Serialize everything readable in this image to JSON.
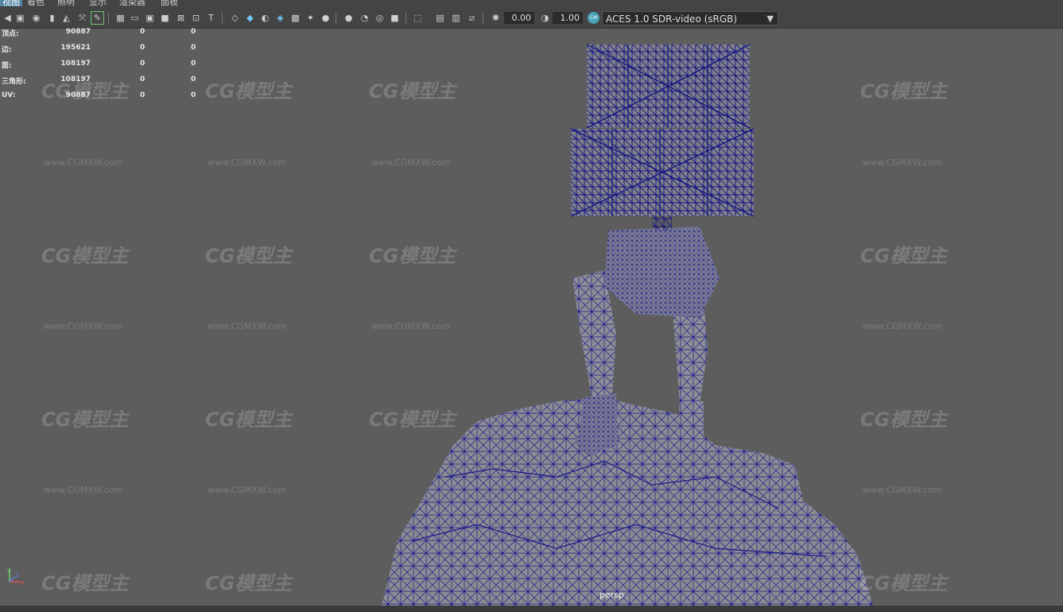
{
  "menu": {
    "items": [
      "视图",
      "着色",
      "照明",
      "显示",
      "渲染器",
      "面板"
    ],
    "active_index": 0
  },
  "toolbar": {
    "exposure_value": "0.00",
    "gamma_value": "1.00",
    "color_space_badge": "CM",
    "color_space": "ACES 1.0 SDR-video (sRGB)",
    "icons": [
      "camera-select-icon",
      "camera-attributes-icon",
      "bookmark-icon",
      "image-plane-icon",
      "grease-pencil-icon",
      "grid-icon",
      "film-gate-icon",
      "resolution-gate-icon",
      "gate-mask-icon",
      "field-chart-icon",
      "safe-action-icon",
      "safe-title-icon",
      "wireframe-icon",
      "smooth-shade-icon",
      "default-material-icon",
      "wireframe-on-shaded-icon",
      "textured-icon",
      "lights-icon",
      "shadows-icon",
      "ambient-occlusion-icon",
      "motion-blur-icon",
      "anti-alias-icon",
      "depth-of-field-icon",
      "isolate-select-icon",
      "xray-icon",
      "xray-joints-icon",
      "backface-culling-icon",
      "exposure-icon",
      "gamma-icon"
    ]
  },
  "hud": {
    "rows": [
      {
        "label": "顶点:",
        "c1": "90887",
        "c2": "0",
        "c3": "0"
      },
      {
        "label": "边:",
        "c1": "195621",
        "c2": "0",
        "c3": "0"
      },
      {
        "label": "面:",
        "c1": "108197",
        "c2": "0",
        "c3": "0"
      },
      {
        "label": "三角形:",
        "c1": "108197",
        "c2": "0",
        "c3": "0"
      },
      {
        "label": "UV:",
        "c1": "90887",
        "c2": "0",
        "c3": "0"
      }
    ]
  },
  "viewport": {
    "camera_label": "persp",
    "wireframe_color": "#1a1a8c",
    "background_color": "#5d5d5d"
  },
  "watermark": {
    "logo_text": "CG模型主",
    "url_text": "www.CGMXW.com"
  },
  "axis": {
    "y": "Y",
    "x": "X",
    "z": "Z"
  }
}
